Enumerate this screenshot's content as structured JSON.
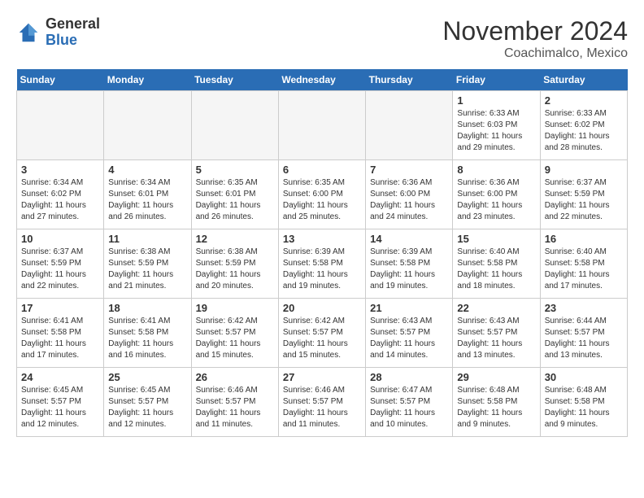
{
  "logo": {
    "general": "General",
    "blue": "Blue"
  },
  "title": {
    "month": "November 2024",
    "location": "Coachimalco, Mexico"
  },
  "headers": [
    "Sunday",
    "Monday",
    "Tuesday",
    "Wednesday",
    "Thursday",
    "Friday",
    "Saturday"
  ],
  "weeks": [
    [
      {
        "day": "",
        "info": ""
      },
      {
        "day": "",
        "info": ""
      },
      {
        "day": "",
        "info": ""
      },
      {
        "day": "",
        "info": ""
      },
      {
        "day": "",
        "info": ""
      },
      {
        "day": "1",
        "info": "Sunrise: 6:33 AM\nSunset: 6:03 PM\nDaylight: 11 hours\nand 29 minutes."
      },
      {
        "day": "2",
        "info": "Sunrise: 6:33 AM\nSunset: 6:02 PM\nDaylight: 11 hours\nand 28 minutes."
      }
    ],
    [
      {
        "day": "3",
        "info": "Sunrise: 6:34 AM\nSunset: 6:02 PM\nDaylight: 11 hours\nand 27 minutes."
      },
      {
        "day": "4",
        "info": "Sunrise: 6:34 AM\nSunset: 6:01 PM\nDaylight: 11 hours\nand 26 minutes."
      },
      {
        "day": "5",
        "info": "Sunrise: 6:35 AM\nSunset: 6:01 PM\nDaylight: 11 hours\nand 26 minutes."
      },
      {
        "day": "6",
        "info": "Sunrise: 6:35 AM\nSunset: 6:00 PM\nDaylight: 11 hours\nand 25 minutes."
      },
      {
        "day": "7",
        "info": "Sunrise: 6:36 AM\nSunset: 6:00 PM\nDaylight: 11 hours\nand 24 minutes."
      },
      {
        "day": "8",
        "info": "Sunrise: 6:36 AM\nSunset: 6:00 PM\nDaylight: 11 hours\nand 23 minutes."
      },
      {
        "day": "9",
        "info": "Sunrise: 6:37 AM\nSunset: 5:59 PM\nDaylight: 11 hours\nand 22 minutes."
      }
    ],
    [
      {
        "day": "10",
        "info": "Sunrise: 6:37 AM\nSunset: 5:59 PM\nDaylight: 11 hours\nand 22 minutes."
      },
      {
        "day": "11",
        "info": "Sunrise: 6:38 AM\nSunset: 5:59 PM\nDaylight: 11 hours\nand 21 minutes."
      },
      {
        "day": "12",
        "info": "Sunrise: 6:38 AM\nSunset: 5:59 PM\nDaylight: 11 hours\nand 20 minutes."
      },
      {
        "day": "13",
        "info": "Sunrise: 6:39 AM\nSunset: 5:58 PM\nDaylight: 11 hours\nand 19 minutes."
      },
      {
        "day": "14",
        "info": "Sunrise: 6:39 AM\nSunset: 5:58 PM\nDaylight: 11 hours\nand 19 minutes."
      },
      {
        "day": "15",
        "info": "Sunrise: 6:40 AM\nSunset: 5:58 PM\nDaylight: 11 hours\nand 18 minutes."
      },
      {
        "day": "16",
        "info": "Sunrise: 6:40 AM\nSunset: 5:58 PM\nDaylight: 11 hours\nand 17 minutes."
      }
    ],
    [
      {
        "day": "17",
        "info": "Sunrise: 6:41 AM\nSunset: 5:58 PM\nDaylight: 11 hours\nand 17 minutes."
      },
      {
        "day": "18",
        "info": "Sunrise: 6:41 AM\nSunset: 5:58 PM\nDaylight: 11 hours\nand 16 minutes."
      },
      {
        "day": "19",
        "info": "Sunrise: 6:42 AM\nSunset: 5:57 PM\nDaylight: 11 hours\nand 15 minutes."
      },
      {
        "day": "20",
        "info": "Sunrise: 6:42 AM\nSunset: 5:57 PM\nDaylight: 11 hours\nand 15 minutes."
      },
      {
        "day": "21",
        "info": "Sunrise: 6:43 AM\nSunset: 5:57 PM\nDaylight: 11 hours\nand 14 minutes."
      },
      {
        "day": "22",
        "info": "Sunrise: 6:43 AM\nSunset: 5:57 PM\nDaylight: 11 hours\nand 13 minutes."
      },
      {
        "day": "23",
        "info": "Sunrise: 6:44 AM\nSunset: 5:57 PM\nDaylight: 11 hours\nand 13 minutes."
      }
    ],
    [
      {
        "day": "24",
        "info": "Sunrise: 6:45 AM\nSunset: 5:57 PM\nDaylight: 11 hours\nand 12 minutes."
      },
      {
        "day": "25",
        "info": "Sunrise: 6:45 AM\nSunset: 5:57 PM\nDaylight: 11 hours\nand 12 minutes."
      },
      {
        "day": "26",
        "info": "Sunrise: 6:46 AM\nSunset: 5:57 PM\nDaylight: 11 hours\nand 11 minutes."
      },
      {
        "day": "27",
        "info": "Sunrise: 6:46 AM\nSunset: 5:57 PM\nDaylight: 11 hours\nand 11 minutes."
      },
      {
        "day": "28",
        "info": "Sunrise: 6:47 AM\nSunset: 5:57 PM\nDaylight: 11 hours\nand 10 minutes."
      },
      {
        "day": "29",
        "info": "Sunrise: 6:48 AM\nSunset: 5:58 PM\nDaylight: 11 hours\nand 9 minutes."
      },
      {
        "day": "30",
        "info": "Sunrise: 6:48 AM\nSunset: 5:58 PM\nDaylight: 11 hours\nand 9 minutes."
      }
    ]
  ]
}
